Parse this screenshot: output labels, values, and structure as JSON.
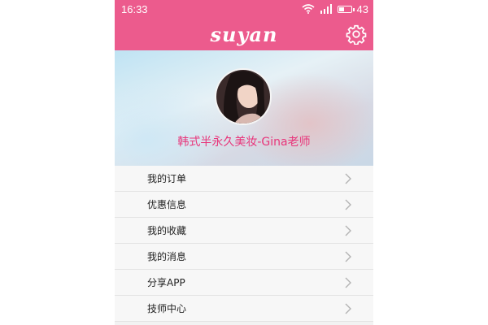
{
  "status_bar": {
    "time": "16:33",
    "battery_level": "43",
    "battery_fraction": 0.43
  },
  "header": {
    "brand": "suyan"
  },
  "profile": {
    "name": "韩式半永久美妆-Gina老师"
  },
  "menu": {
    "items": [
      {
        "label": "我的订单"
      },
      {
        "label": "优惠信息"
      },
      {
        "label": "我的收藏"
      },
      {
        "label": "我的消息"
      },
      {
        "label": "分享APP"
      },
      {
        "label": "技师中心"
      }
    ]
  },
  "colors": {
    "accent": "#ec5b8d",
    "name_text": "#e8357a"
  },
  "icons": {
    "settings": "gear-icon",
    "chevron": "chevron-right-icon",
    "wifi": "wifi-icon",
    "signal": "signal-icon",
    "battery": "battery-icon"
  }
}
